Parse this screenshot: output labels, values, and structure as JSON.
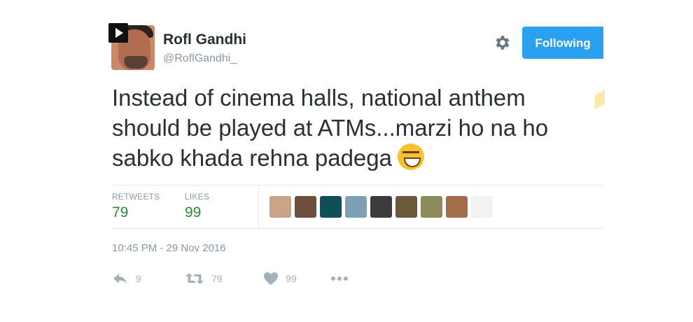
{
  "tweet": {
    "display_name": "Rofl Gandhi",
    "handle": "@RoflGandhi_",
    "follow_button": "Following",
    "text_lines": [
      "Instead of cinema halls, national anthem",
      "should be played at ATMs...marzi ho na ho",
      "sabko khada rehna padega"
    ],
    "emoji": "laughing-cat-face",
    "stats": {
      "retweets_label": "RETWEETS",
      "retweets_count": "79",
      "likes_label": "LIKES",
      "likes_count": "99"
    },
    "timestamp": "10:45 PM - 29 Nov 2016",
    "actions": {
      "reply_count": "9",
      "retweet_count": "79",
      "like_count": "99"
    }
  },
  "icons": {
    "play": "play-icon",
    "settings": "gear-icon",
    "reply": "reply-icon",
    "retweet": "retweet-icon",
    "like": "heart-icon",
    "more": "more-icon"
  },
  "colors": {
    "follow_button": "#2b9ff0",
    "stat_counts": "#2e8a3a",
    "muted_text": "#8899a6"
  },
  "likers": [
    {
      "name": "liker-1",
      "color": "#c9a489"
    },
    {
      "name": "liker-2",
      "color": "#6e4e3c"
    },
    {
      "name": "liker-3",
      "color": "#0f4f56"
    },
    {
      "name": "liker-4",
      "color": "#7fa1b5"
    },
    {
      "name": "liker-5",
      "color": "#3b3b3b"
    },
    {
      "name": "liker-6",
      "color": "#6b5a3a"
    },
    {
      "name": "liker-7",
      "color": "#8e8a5a"
    },
    {
      "name": "liker-8",
      "color": "#a56e4a"
    },
    {
      "name": "liker-9",
      "color": "#f2f2f2"
    }
  ]
}
